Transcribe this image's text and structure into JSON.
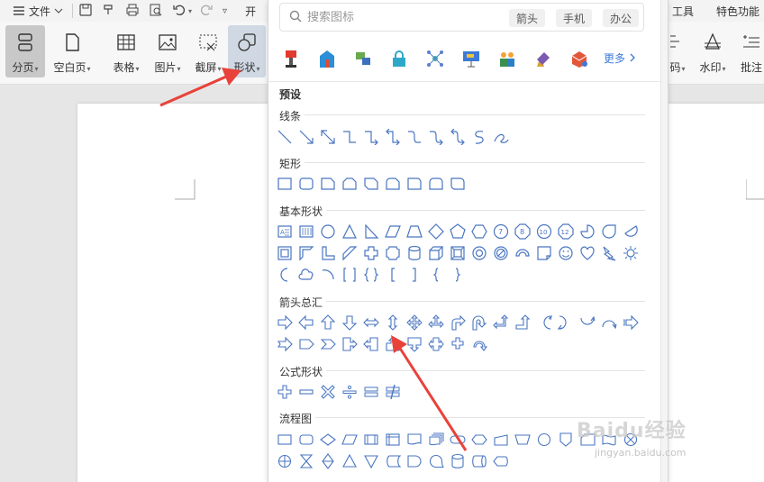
{
  "menubar": {
    "file_label": "文件",
    "tools_label": "工具",
    "features_label": "特色功能",
    "partial_label": "开"
  },
  "ribbon": {
    "page_break": "分页",
    "blank_page": "空白页",
    "table": "表格",
    "picture": "图片",
    "screenshot": "截屏",
    "shapes": "形状",
    "right_partial": "码",
    "watermark": "水印",
    "comment_partial": "批注"
  },
  "panel": {
    "search_placeholder": "搜索图标",
    "tags": [
      "箭头",
      "手机",
      "办公"
    ],
    "more_label": "更多",
    "preset_title": "预设",
    "categories": {
      "lines": "线条",
      "rectangles": "矩形",
      "basic": "基本形状",
      "arrows": "箭头总汇",
      "equations": "公式形状",
      "flowchart": "流程图"
    }
  },
  "colors": {
    "shape_stroke": "#4a76c0",
    "accent": "#3d7ad8",
    "annotation_arrow": "#e8423a"
  },
  "watermark": {
    "main": "Baidu经验",
    "sub": "jingyan.baidu.com"
  }
}
